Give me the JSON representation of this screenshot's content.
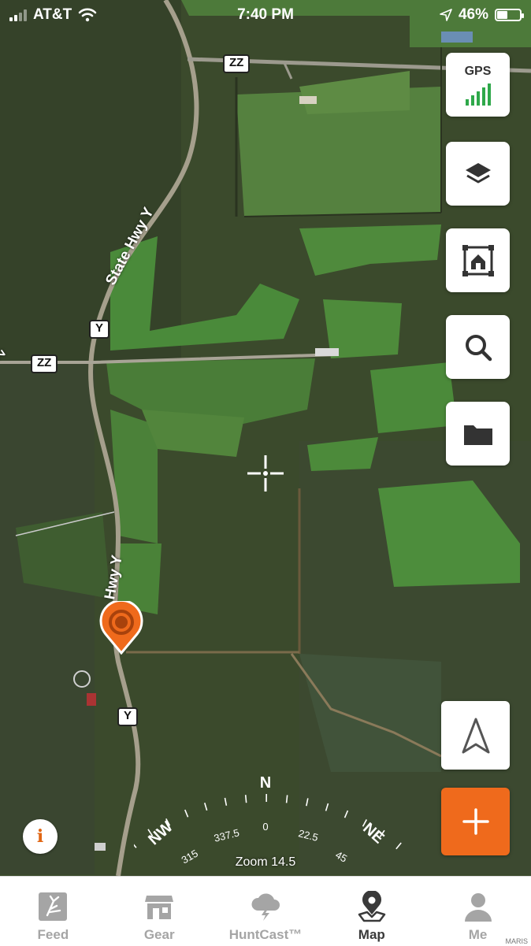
{
  "status_bar": {
    "carrier": "AT&T",
    "time": "7:40 PM",
    "battery_percent": "46%",
    "battery_level": 0.46,
    "icons": [
      "cell-signal-icon",
      "wifi-icon",
      "location-arrow-icon",
      "battery-icon"
    ]
  },
  "map": {
    "road_shields": [
      "ZZ",
      "Y",
      "ZZ",
      "Y",
      "Y"
    ],
    "road_labels": [
      "State Hwy Y",
      "Hwy Y"
    ],
    "edge_letter": "Z",
    "zoom_text": "Zoom 14.5"
  },
  "compass": {
    "cardinals": [
      "N",
      "NW",
      "NE"
    ],
    "degrees": [
      "337.5",
      "0",
      "22.5",
      "315",
      "45"
    ]
  },
  "side_buttons": {
    "gps_label": "GPS",
    "items": [
      "gps-status-button",
      "layers-button",
      "home-area-button",
      "search-button",
      "folder-button"
    ]
  },
  "info_button": "i",
  "tab_bar": {
    "active": "Map",
    "tabs": [
      {
        "label": "Feed",
        "icon": "antler-icon"
      },
      {
        "label": "Gear",
        "icon": "store-icon"
      },
      {
        "label": "HuntCast™",
        "icon": "weather-icon"
      },
      {
        "label": "Map",
        "icon": "map-pin-icon"
      },
      {
        "label": "Me",
        "icon": "person-icon"
      }
    ]
  },
  "watermark": "MARIS",
  "colors": {
    "accent_orange": "#ef6a1c",
    "gps_green": "#2ea84a",
    "tab_active": "#3a3a3a",
    "tab_inactive": "#a5a5a5"
  }
}
